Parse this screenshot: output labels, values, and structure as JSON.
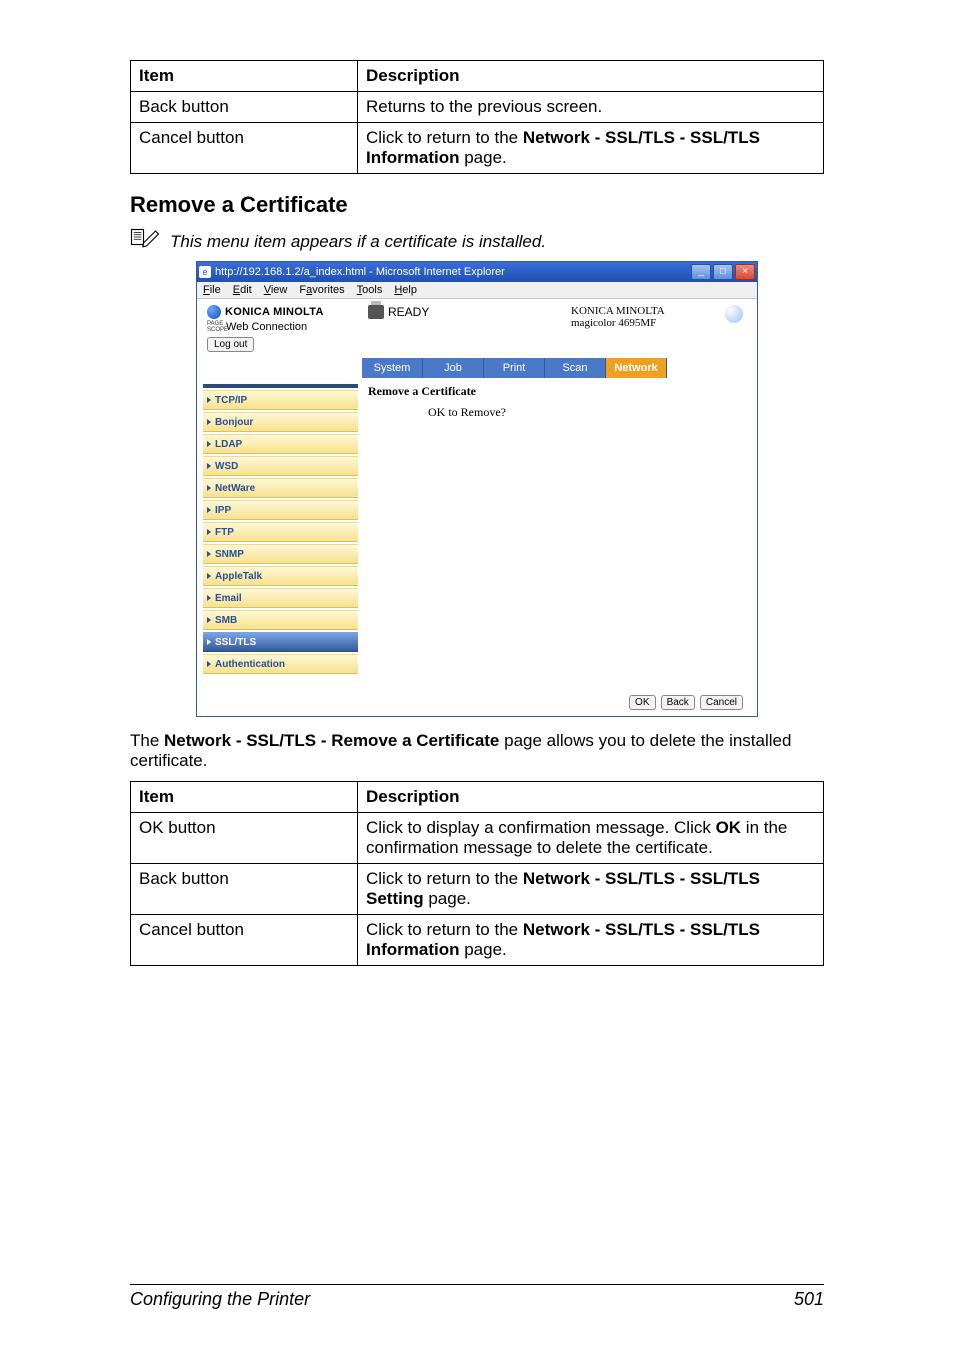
{
  "table1": {
    "headers": [
      "Item",
      "Description"
    ],
    "rows": [
      {
        "item": "Back button",
        "desc_plain": "Returns to the previous screen."
      },
      {
        "item": "Cancel button",
        "desc_pre": "Click to return to the ",
        "desc_bold": "Network - SSL/TLS - SSL/TLS Information",
        "desc_post": " page."
      }
    ]
  },
  "section_title": "Remove a Certificate",
  "note": "This menu item appears if a certificate is installed.",
  "browser": {
    "title": "http://192.168.1.2/a_index.html - Microsoft Internet Explorer",
    "menus": {
      "file": "File",
      "edit": "Edit",
      "view": "View",
      "favorites": "Favorites",
      "tools": "Tools",
      "help": "Help"
    },
    "brand": "KONICA MINOLTA",
    "wc_pre": "PAGE\nSCOPE",
    "wc_label": "Web Connection",
    "status": "READY",
    "right1": "KONICA MINOLTA",
    "right2": "magicolor 4695MF",
    "logout": "Log out",
    "tabs": [
      "System",
      "Job",
      "Print",
      "Scan",
      "Network"
    ],
    "active_tab": 4,
    "sidebar": [
      "TCP/IP",
      "Bonjour",
      "LDAP",
      "WSD",
      "NetWare",
      "IPP",
      "FTP",
      "SNMP",
      "AppleTalk",
      "Email",
      "SMB",
      "SSL/TLS",
      "Authentication"
    ],
    "active_side": 11,
    "main_title": "Remove a Certificate",
    "main_sub": "OK to Remove?",
    "buttons": {
      "ok": "OK",
      "back": "Back",
      "cancel": "Cancel"
    }
  },
  "body_para_pre": "The ",
  "body_para_bold": "Network - SSL/TLS - Remove a Certificate",
  "body_para_post": " page allows you to delete the installed certificate.",
  "table2": {
    "headers": [
      "Item",
      "Description"
    ],
    "rows": [
      {
        "item": "OK button",
        "desc_pre": "Click to display a confirmation message. Click ",
        "desc_bold": "OK",
        "desc_post": " in the confirmation message to delete the certificate."
      },
      {
        "item": "Back button",
        "desc_pre": "Click to return to the ",
        "desc_bold": "Network - SSL/TLS - SSL/TLS Setting",
        "desc_post": " page."
      },
      {
        "item": "Cancel button",
        "desc_pre": "Click to return to the ",
        "desc_bold": "Network - SSL/TLS - SSL/TLS Information",
        "desc_post": " page."
      }
    ]
  },
  "footer_left": "Configuring the Printer",
  "footer_right": "501"
}
